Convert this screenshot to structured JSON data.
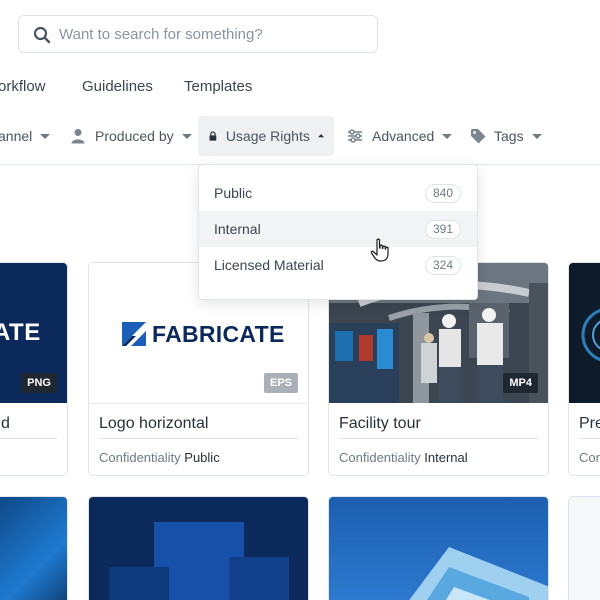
{
  "search": {
    "placeholder": "Want to search for something?"
  },
  "nav": {
    "tabs": [
      {
        "label": "orkflow"
      },
      {
        "label": "Guidelines"
      },
      {
        "label": "Templates"
      }
    ]
  },
  "filters": {
    "channel": {
      "label": "annel",
      "icon": "chevron-down-icon"
    },
    "produced_by": {
      "label": "Produced by",
      "icon": "user-icon"
    },
    "usage_rights": {
      "label": "Usage Rights",
      "icon": "lock-icon"
    },
    "advanced": {
      "label": "Advanced",
      "icon": "sliders-icon"
    },
    "tags": {
      "label": "Tags",
      "icon": "tag-icon"
    }
  },
  "dropdown": {
    "items": [
      {
        "label": "Public",
        "count": "840"
      },
      {
        "label": "Internal",
        "count": "391"
      },
      {
        "label": "Licensed Material",
        "count": "324"
      }
    ]
  },
  "cards": [
    {
      "thumb_text": "ATE",
      "badge": "PNG",
      "title": "d",
      "meta_label": "",
      "meta_value": ""
    },
    {
      "logo_text": "FABRICATE",
      "badge": "EPS",
      "title": "Logo horizontal",
      "meta_label": "Confidentiality",
      "meta_value": "Public"
    },
    {
      "badge": "MP4",
      "title": "Facility tour",
      "meta_label": "Confidentiality",
      "meta_value": "Internal"
    },
    {
      "title": "Pre",
      "meta_label": "Con",
      "meta_value": ""
    }
  ],
  "colors": {
    "brand_navy": "#0b2a5b",
    "brand_blue": "#1c5fb8",
    "badge_gray": "#a9b0b7",
    "badge_dark": "#1f2730"
  }
}
